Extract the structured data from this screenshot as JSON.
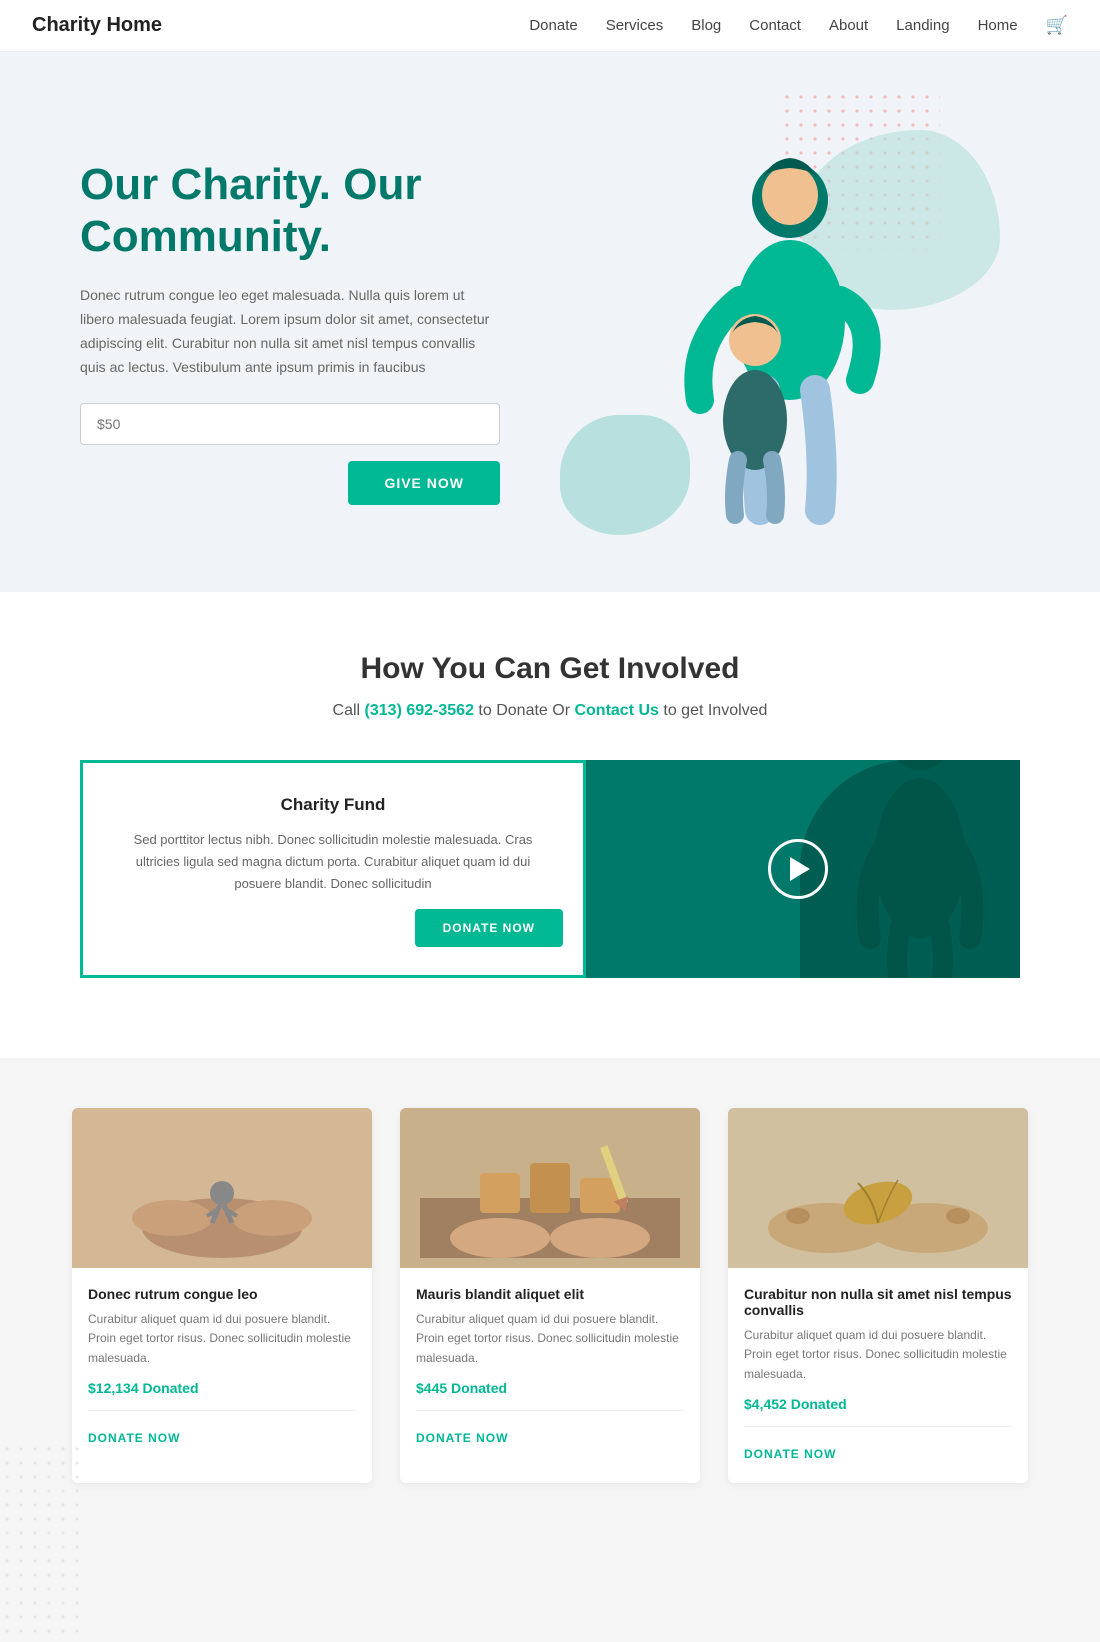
{
  "brand": "Charity Home",
  "nav": {
    "links": [
      {
        "label": "Donate",
        "href": "#"
      },
      {
        "label": "Services",
        "href": "#"
      },
      {
        "label": "Blog",
        "href": "#"
      },
      {
        "label": "Contact",
        "href": "#"
      },
      {
        "label": "About",
        "href": "#"
      },
      {
        "label": "Landing",
        "href": "#"
      },
      {
        "label": "Home",
        "href": "#"
      }
    ]
  },
  "hero": {
    "title": "Our Charity. Our Community.",
    "description": "Donec rutrum congue leo eget malesuada. Nulla quis lorem ut libero malesuada feugiat. Lorem ipsum dolor sit amet, consectetur adipiscing elit. Curabitur non nulla sit amet nisl tempus convallis quis ac lectus.  Vestibulum ante ipsum primis in faucibus",
    "input_placeholder": "$50",
    "cta_label": "GIVE NOW"
  },
  "involvement": {
    "title": "How You Can Get Involved",
    "subtitle_text": "Call ",
    "phone": "(313) 692-3562",
    "subtitle_middle": " to Donate Or ",
    "contact_link": "Contact Us",
    "subtitle_end": " to get Involved"
  },
  "fund": {
    "title": "Charity Fund",
    "description": "Sed porttitor lectus nibh. Donec sollicitudin molestie malesuada. Cras ultricies ligula sed magna dictum porta. Curabitur aliquet quam id dui posuere blandit. Donec sollicitudin",
    "cta_label": "DONATE NOW"
  },
  "video": {
    "play_label": "Play video"
  },
  "causes": [
    {
      "title": "Donec rutrum congue leo",
      "description": "Curabitur aliquet quam id dui posuere blandit. Proin eget tortor risus. Donec sollicitudin molestie malesuada.",
      "amount": "$12,134 Donated",
      "cta_label": "DONATE NOW"
    },
    {
      "title": "Mauris blandit aliquet elit",
      "description": "Curabitur aliquet quam id dui posuere blandit. Proin eget tortor risus. Donec sollicitudin molestie malesuada.",
      "amount": "$445 Donated",
      "cta_label": "DONATE NOW"
    },
    {
      "title": "Curabitur non nulla sit amet nisl tempus convallis",
      "description": "Curabitur aliquet quam id dui posuere blandit. Proin eget tortor risus. Donec sollicitudin molestie malesuada.",
      "amount": "$4,452 Donated",
      "cta_label": "DONATE NOW"
    }
  ],
  "colors": {
    "primary": "#00b894",
    "dark_primary": "#00796b",
    "accent_dot": "#f4a0a0"
  }
}
